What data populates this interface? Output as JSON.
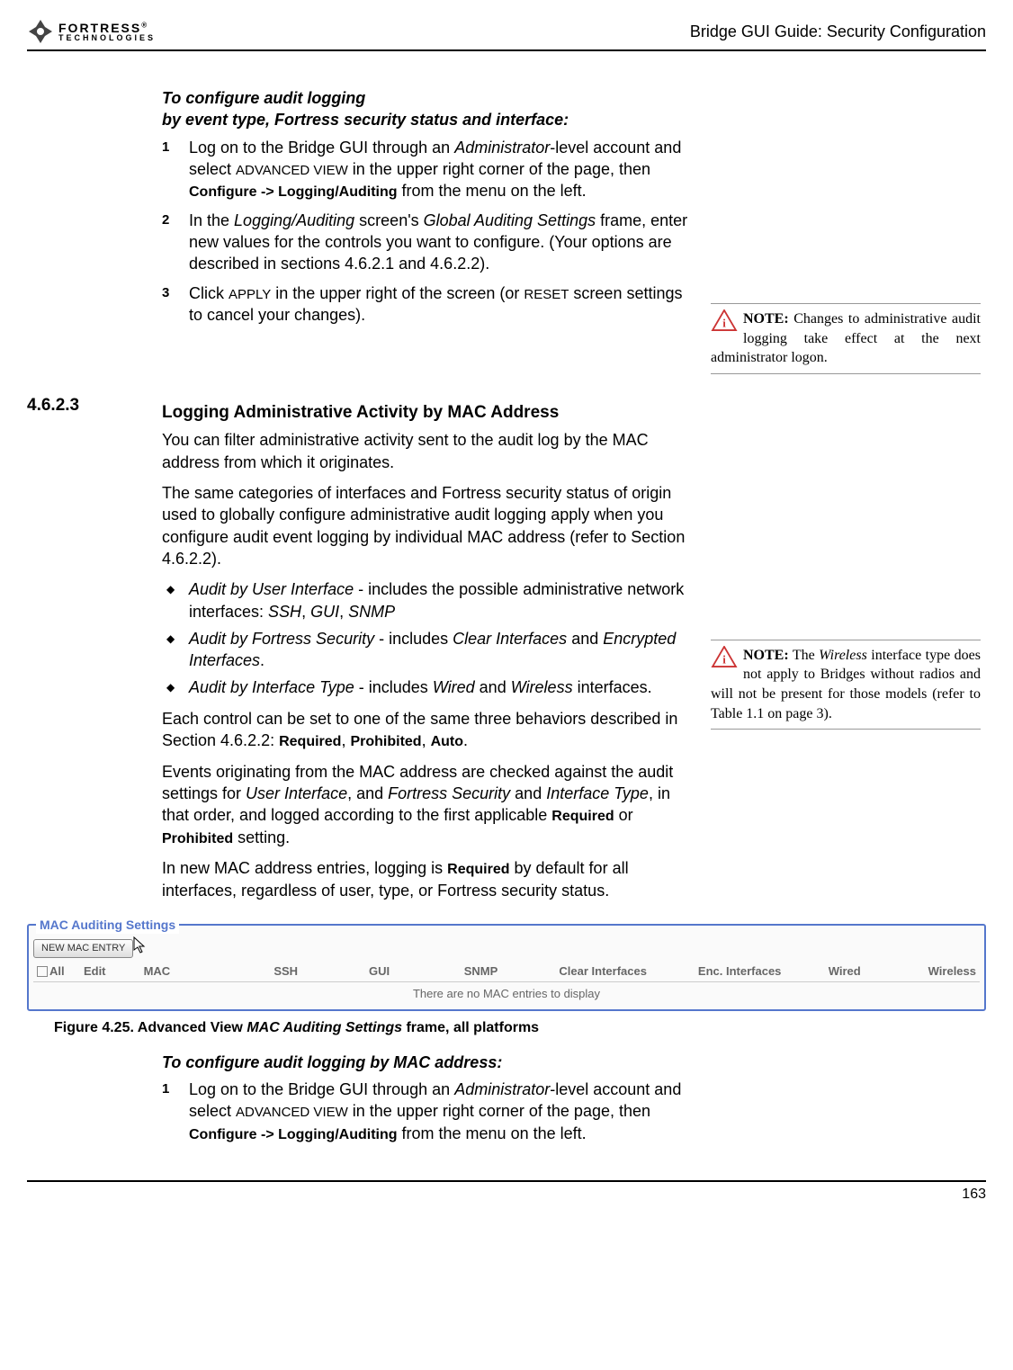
{
  "header": {
    "logo_main": "FORTRESS",
    "logo_sub": "TECHNOLOGIES",
    "breadcrumb": "Bridge GUI Guide: Security Configuration"
  },
  "proc1": {
    "title_l1": "To configure audit logging",
    "title_l2": "by event type, Fortress security status and interface:",
    "steps": [
      {
        "n": "1",
        "prefix": "Log on to the Bridge GUI through an ",
        "it1": "Administrator",
        "mid1": "-level account and select ",
        "sc1": "ADVANCED VIEW",
        "mid2": " in the upper right corner of the page, then ",
        "b1": "Configure -> Logging/Auditing",
        "tail": " from the menu on the left."
      },
      {
        "n": "2",
        "prefix": "In the ",
        "it1": "Logging/Auditing",
        "mid1": " screen's ",
        "it2": "Global Auditing Settings",
        "tail": " frame, enter new values for the controls you want to configure. (Your options are described in sections 4.6.2.1 and 4.6.2.2)."
      },
      {
        "n": "3",
        "prefix": "Click ",
        "sc1": "APPLY",
        "mid1": " in the upper right of the screen (or ",
        "sc2": "RESET",
        "tail": " screen settings to cancel your changes)."
      }
    ]
  },
  "section": {
    "num": "4.6.2.3",
    "title": "Logging Administrative Activity by MAC Address",
    "p1": "You can filter administrative activity sent to the audit log by the MAC address from which it originates.",
    "p2": "The same categories of interfaces and Fortress security status of origin used to globally configure administrative audit logging apply when you configure audit event logging by individual MAC address (refer to Section 4.6.2.2).",
    "bullets": [
      {
        "b": "Audit by User Interface",
        "mid": " - includes the possible administrative network interfaces: ",
        "it": "SSH",
        "c1": ", ",
        "it2": "GUI",
        "c2": ", ",
        "it3": "SNMP"
      },
      {
        "b": "Audit by Fortress Security",
        "mid": " - includes ",
        "it": "Clear Interfaces",
        "c1": " and ",
        "it2": "Encrypted Interfaces",
        "tail": "."
      },
      {
        "b": "Audit by Interface Type",
        "mid": " - includes ",
        "it": "Wired",
        "c1": " and ",
        "it2": "Wireless",
        "tail": " interfaces."
      }
    ],
    "p3_pre": "Each control can be set to one of the same three behaviors described in Section 4.6.2.2: ",
    "p3_b1": "Required",
    "p3_c1": ", ",
    "p3_b2": "Prohibited",
    "p3_c2": ", ",
    "p3_b3": "Auto",
    "p3_tail": ".",
    "p4_pre": "Events originating from the MAC address are checked against the audit settings for ",
    "p4_i1": "User Interface",
    "p4_m1": ", and ",
    "p4_i2": "Fortress Security",
    "p4_m2": " and ",
    "p4_i3": "Interface Type",
    "p4_m3": ", in that order, and logged according to the first applicable ",
    "p4_b1": "Required",
    "p4_m4": " or ",
    "p4_b2": "Prohibited",
    "p4_tail": " setting.",
    "p5_pre": "In new MAC address entries, logging is ",
    "p5_b": "Required",
    "p5_tail": " by default for all interfaces, regardless of user, type, or Fortress security status."
  },
  "notes": {
    "n1_label": "NOTE:",
    "n1_text": " Changes to administrative audit logging take effect at the next administrator logon.",
    "n2_label": "NOTE:",
    "n2_pre": " The ",
    "n2_it": "Wireless",
    "n2_tail": " interface type does not apply to Bridges without radios and will not be present for those models (refer to Table 1.1 on page 3)."
  },
  "figure": {
    "legend": "MAC Auditing Settings",
    "button": "NEW MAC ENTRY",
    "cols": {
      "all": "All",
      "edit": "Edit",
      "mac": "MAC",
      "ssh": "SSH",
      "gui": "GUI",
      "snmp": "SNMP",
      "ci": "Clear Interfaces",
      "ei": "Enc. Interfaces",
      "w": "Wired",
      "wl": "Wireless"
    },
    "empty": "There are no MAC entries to display",
    "caption_pre": "Figure 4.25. Advanced View ",
    "caption_it": "MAC Auditing Settings",
    "caption_tail": " frame, all platforms"
  },
  "proc2": {
    "title": "To configure audit logging by MAC address:",
    "step": {
      "n": "1",
      "prefix": "Log on to the Bridge GUI through an ",
      "it1": "Administrator",
      "mid1": "-level account and select ",
      "sc1": "ADVANCED VIEW",
      "mid2": " in the upper right corner of the page, then ",
      "b1": "Configure -> Logging/Auditing",
      "tail": " from the menu on the left."
    }
  },
  "page": "163"
}
